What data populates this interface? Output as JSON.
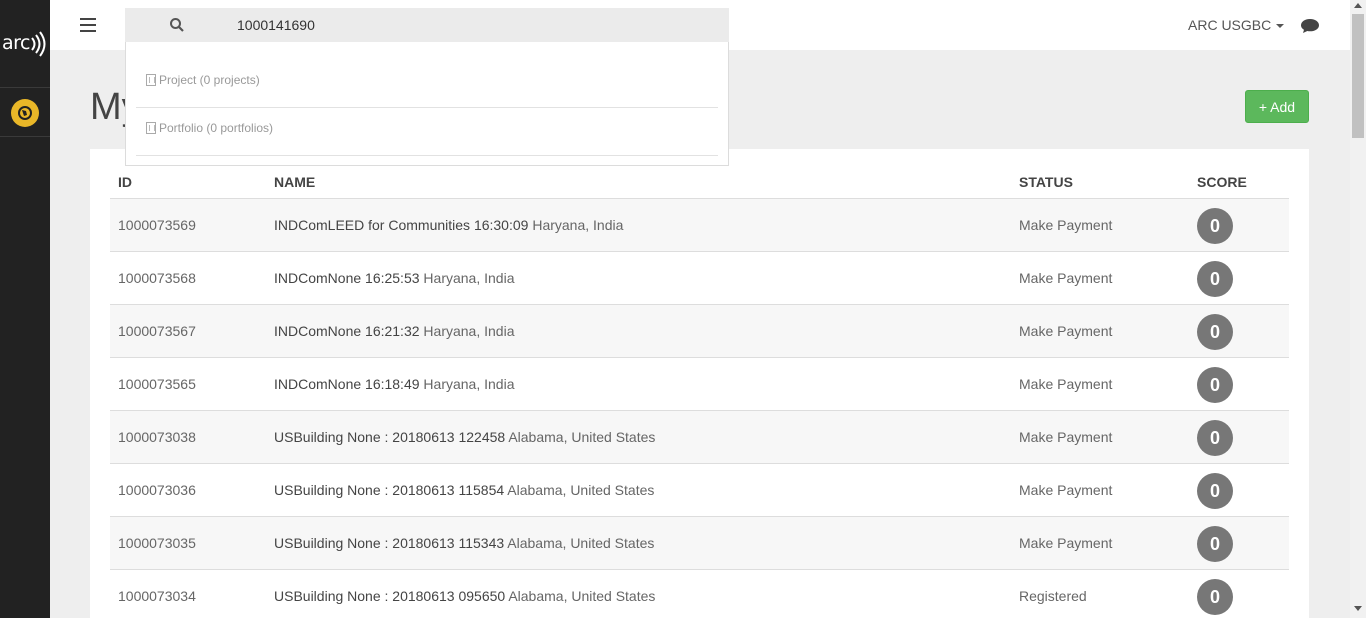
{
  "sidebar": {
    "logo_text": "arc",
    "logo_icon": "signal-waves-icon",
    "items": [
      {
        "icon": "globe-icon",
        "color": "#e9b728"
      }
    ]
  },
  "header": {
    "menu_icon": "hamburger-icon",
    "search": {
      "value": "1000141690",
      "icon": "search-icon"
    },
    "user_menu_label": "ARC USGBC",
    "chat_icon": "chat-icon"
  },
  "search_dropdown": {
    "items": [
      {
        "label": "Project (0 projects)",
        "icon": "building-icon"
      },
      {
        "label": "Portfolio (0 portfolios)",
        "icon": "building-icon"
      }
    ]
  },
  "page": {
    "title": "My Projects",
    "add_button_label": "+ Add",
    "accent_color": "#5cb85c"
  },
  "table": {
    "columns": [
      "ID",
      "NAME",
      "STATUS",
      "SCORE"
    ],
    "rows": [
      {
        "id": "1000073569",
        "name": "INDComLEED for Communities 16:30:09",
        "location": "Haryana, India",
        "status": "Make Payment",
        "score": "0"
      },
      {
        "id": "1000073568",
        "name": "INDComNone 16:25:53",
        "location": "Haryana, India",
        "status": "Make Payment",
        "score": "0"
      },
      {
        "id": "1000073567",
        "name": "INDComNone 16:21:32",
        "location": "Haryana, India",
        "status": "Make Payment",
        "score": "0"
      },
      {
        "id": "1000073565",
        "name": "INDComNone 16:18:49",
        "location": "Haryana, India",
        "status": "Make Payment",
        "score": "0"
      },
      {
        "id": "1000073038",
        "name": "USBuilding None : 20180613 122458",
        "location": "Alabama, United States",
        "status": "Make Payment",
        "score": "0"
      },
      {
        "id": "1000073036",
        "name": "USBuilding None : 20180613 115854",
        "location": "Alabama, United States",
        "status": "Make Payment",
        "score": "0"
      },
      {
        "id": "1000073035",
        "name": "USBuilding None : 20180613 115343",
        "location": "Alabama, United States",
        "status": "Make Payment",
        "score": "0"
      },
      {
        "id": "1000073034",
        "name": "USBuilding None : 20180613 095650",
        "location": "Alabama, United States",
        "status": "Registered",
        "score": "0"
      }
    ]
  }
}
